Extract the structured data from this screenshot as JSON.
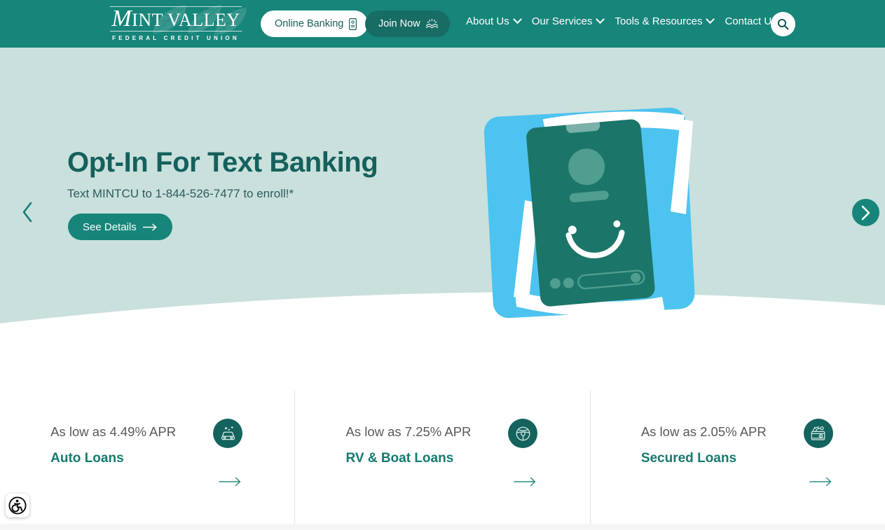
{
  "colors": {
    "header_teal": "#17857a",
    "dark_teal": "#14635e",
    "hero_bg": "#c9e0dc",
    "hero_title": "#15605c",
    "card_title": "#157a70",
    "card_rate": "#595959",
    "art_blue": "#4dc3f0",
    "join_btn": "#176c64"
  },
  "header": {
    "logo": {
      "name_first_letter": "M",
      "name_rest": "INT VALLEY",
      "tagline": "FEDERAL CREDIT UNION",
      "leaf_icon": "mint-leaf-watermark"
    },
    "online_banking_label": "Online Banking",
    "online_banking_icon": "mobile-phone-icon",
    "join_now_label": "Join Now",
    "join_now_icon": "hands-sparkle-icon",
    "search_icon": "search-icon",
    "nav": [
      {
        "label": "About Us",
        "has_dropdown": true
      },
      {
        "label": "Our Services",
        "has_dropdown": true
      },
      {
        "label": "Tools & Resources",
        "has_dropdown": true
      },
      {
        "label": "Contact Us",
        "has_dropdown": false
      }
    ]
  },
  "hero": {
    "title": "Opt-In For Text Banking",
    "subtitle": "Text MINTCU to 1-844-526-7477 to enroll!*",
    "cta_label": "See Details",
    "cta_arrow_icon": "arrow-right-icon",
    "prev_icon": "chevron-left-icon",
    "next_icon": "chevron-right-icon",
    "illustration": "smiling-phone-text-banking-illustration"
  },
  "cards": [
    {
      "rate": "As low as 4.49% APR",
      "title": "Auto Loans",
      "icon": "car-sparkle-icon",
      "arrow_icon": "arrow-right-icon"
    },
    {
      "rate": "As low as 7.25% APR",
      "title": "RV & Boat Loans",
      "icon": "steering-wheel-icon",
      "arrow_icon": "arrow-right-icon"
    },
    {
      "rate": "As low as 2.05% APR",
      "title": "Secured Loans",
      "icon": "wallet-money-icon",
      "arrow_icon": "arrow-right-icon"
    }
  ],
  "accessibility": {
    "label": "Accessibility",
    "icon": "wheelchair-accessibility-icon"
  }
}
